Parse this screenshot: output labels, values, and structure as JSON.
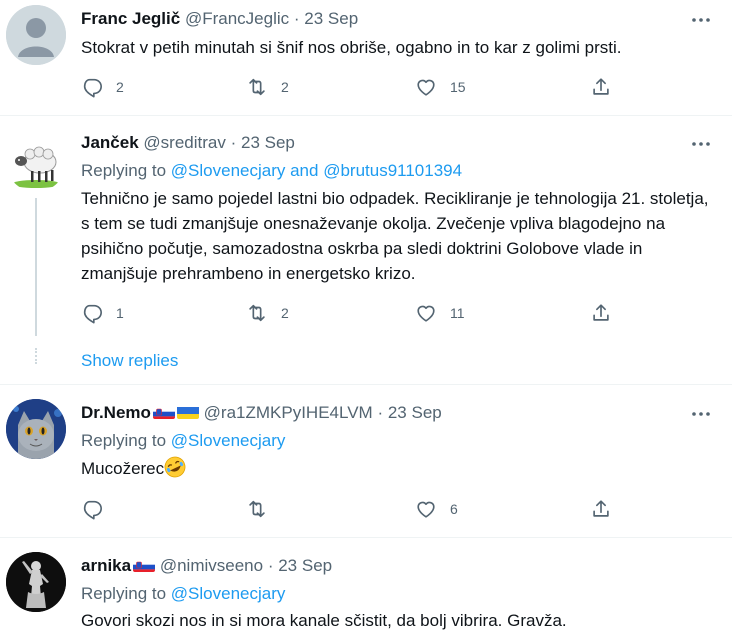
{
  "tweets": [
    {
      "name": "Franc Jeglič",
      "handle": "@FrancJeglic",
      "date": "23 Sep",
      "text": "Stokrat v petih minutah si šnif nos obriše, ogabno in to kar z golimi prsti.",
      "replies": "2",
      "retweets": "2",
      "likes": "15"
    },
    {
      "name": "Janček",
      "handle": "@sreditrav",
      "date": "23 Sep",
      "replying_label": "Replying to",
      "replying_to": "@Slovenecjary and @brutus91101394",
      "text": "Tehnično je samo pojedel lastni bio odpadek. Recikliranje je tehnologija 21. stoletja, s tem se tudi zmanjšuje onesnaževanje okolja. Zvečenje vpliva blagodejno na psihično počutje, samozadostna oskrba pa sledi doktrini Golobove vlade in zmanjšuje  prehrambeno in energetsko krizo.",
      "replies": "1",
      "retweets": "2",
      "likes": "11",
      "show_replies": "Show replies"
    },
    {
      "name": "Dr.Nemo",
      "handle": "@ra1ZMKPyIHE4LVM",
      "date": "23 Sep",
      "replying_label": "Replying to",
      "replying_to": "@Slovenecjary",
      "text": "Mucožerec",
      "replies": "",
      "retweets": "",
      "likes": "6"
    },
    {
      "name": "arnika",
      "handle": "@nimivseeno",
      "date": "23 Sep",
      "replying_label": "Replying to",
      "replying_to": "@Slovenecjary",
      "text": "Govori skozi nos in si mora kanale sčistit, da bolj vibrira. Gravža."
    }
  ],
  "separator": "·",
  "colors": {
    "accent": "#1d9bf0",
    "secondary_text": "#536471",
    "border": "#eff3f4",
    "thread_line": "#cfd9de"
  },
  "icons": [
    "reply-icon",
    "retweet-icon",
    "like-icon",
    "share-icon",
    "more-icon",
    "slovenia-flag-icon",
    "ukraine-flag-icon",
    "rolling-laughing-emoji-icon"
  ]
}
